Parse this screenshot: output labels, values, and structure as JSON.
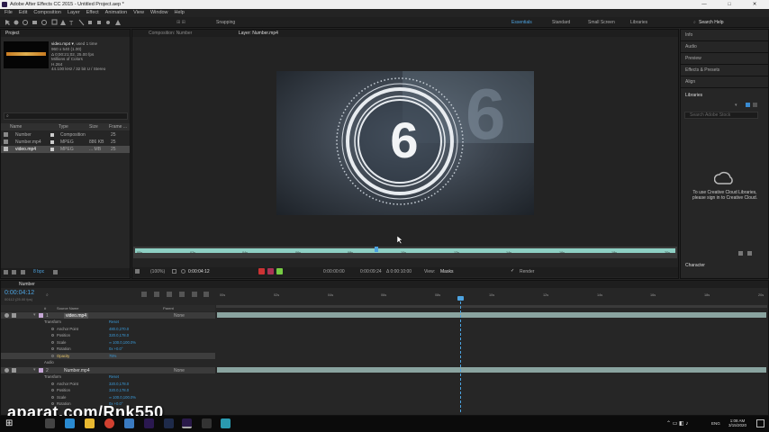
{
  "window": {
    "title": "Adobe After Effects CC 2015 - Untitled Project.aep *",
    "controls": [
      "—",
      "□",
      "✕"
    ]
  },
  "menu": [
    "File",
    "Edit",
    "Composition",
    "Layer",
    "Effect",
    "Animation",
    "View",
    "Window",
    "Help"
  ],
  "toolbar": {
    "snapping": "Snapping",
    "workspaces": [
      "Essentials",
      "Standard",
      "Small Screen",
      "Libraries"
    ],
    "search": "Search Help"
  },
  "project": {
    "tab": "Project",
    "file_name": "video.mp4 ▾",
    "used": ", used 1 time",
    "info": [
      "960 x 540 (1.00)",
      "Δ 0;00:21;02, 25.00 fps",
      "Millions of Colors",
      "H.264",
      "44.100 kHz / 32 bit U / Stereo"
    ],
    "search_placeholder": "⌕",
    "columns": [
      "Name",
      "Type",
      "Size",
      "Frame ..."
    ],
    "items": [
      {
        "name": "Number",
        "type": "Composition",
        "size": "",
        "fr": "25"
      },
      {
        "name": "Number.mp4",
        "type": "MPEG",
        "size": "886 KB",
        "fr": "25"
      },
      {
        "name": "video.mp4",
        "type": "MPEG",
        "size": "... MB",
        "fr": "25"
      }
    ],
    "bpc": "8 bpc"
  },
  "viewer": {
    "tabs": [
      "Composition: Number",
      "Layer: Number.mp4"
    ],
    "countdown": "6",
    "ruler": [
      "00s",
      "02s",
      "04s",
      "06s",
      "08s",
      "10s",
      "12s",
      "14s",
      "16s",
      "18s",
      "20s"
    ],
    "zoom": "(100%)",
    "time": "0:00:04:12",
    "in": "0:00:00:00",
    "out": "0:00:09:24",
    "dur": "Δ 0:00:10:00",
    "view_label": "View:",
    "view_val": "Masks",
    "render": "Render",
    "exposure": "+0.0"
  },
  "right": {
    "panels": [
      "Info",
      "Audio",
      "Preview",
      "Effects & Presets",
      "Align"
    ],
    "libraries": "Libraries",
    "lib_search": "Search Adobe Stock",
    "lib_msg1": "To use Creative Cloud Libraries,",
    "lib_msg2": "please sign in to Creative Cloud.",
    "character": "Character"
  },
  "timeline": {
    "tab": "Number",
    "time": "0:00:04:12",
    "fps": "00112 (25.00 fps)",
    "headers": [
      "#",
      "Source Name",
      "Parent"
    ],
    "ruler": [
      "00s",
      "02s",
      "04s",
      "06s",
      "08s",
      "10s",
      "12s",
      "14s",
      "16s",
      "18s",
      "20s"
    ],
    "layers": [
      {
        "num": "1",
        "name": "video.mp4",
        "parent": "None",
        "props": [
          {
            "n": "Transform",
            "v": "Reset"
          },
          {
            "n": "Anchor Point",
            "v": "480.0,270.0"
          },
          {
            "n": "Position",
            "v": "320.0,178.0"
          },
          {
            "n": "Scale",
            "v": "∞ 100.0,100.0%"
          },
          {
            "n": "Rotation",
            "v": "0x +0.0°"
          },
          {
            "n": "Opacity",
            "v": "75%"
          },
          {
            "n": "Audio",
            "v": ""
          }
        ]
      },
      {
        "num": "2",
        "name": "Number.mp4",
        "parent": "None",
        "props": [
          {
            "n": "Transform",
            "v": "Reset"
          },
          {
            "n": "Anchor Point",
            "v": "320.0,178.0"
          },
          {
            "n": "Position",
            "v": "320.0,178.0"
          },
          {
            "n": "Scale",
            "v": "∞ 100.0,100.0%"
          },
          {
            "n": "Rotation",
            "v": "0x +0.0°"
          }
        ]
      }
    ],
    "toggle": "Toggle Switches / Modes"
  },
  "taskbar": {
    "time": "1:08 AM",
    "date": "3/15/2020",
    "lang": "ENG"
  },
  "watermark": "aparat.com/Rnk550"
}
